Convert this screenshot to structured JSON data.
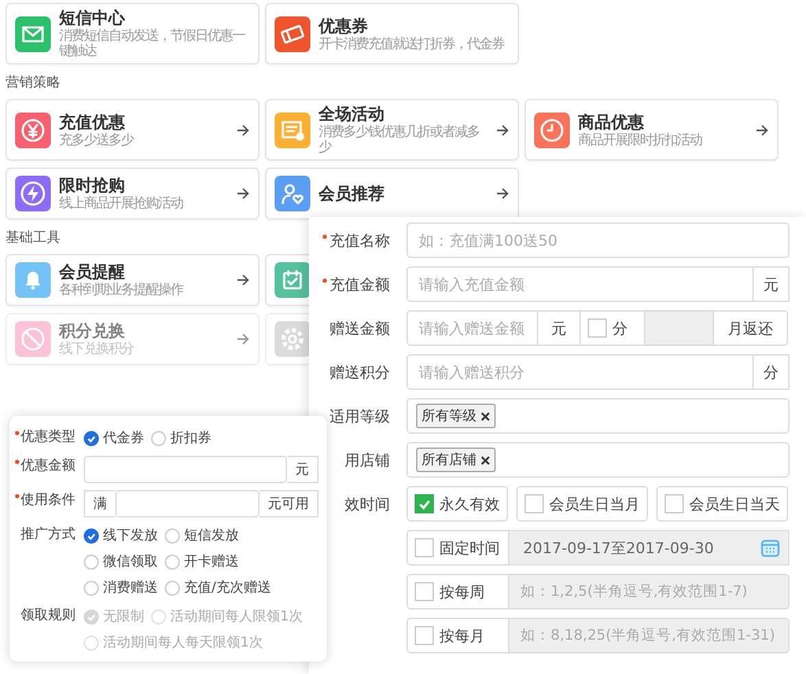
{
  "top_cards": [
    {
      "title": "短信中心",
      "desc": "消费短信自动发送，节假日优惠一键触达"
    },
    {
      "title": "优惠券",
      "desc": "开卡消费充值就送打折券，代金券"
    }
  ],
  "sections": [
    {
      "title": "营销策略",
      "rows": [
        [
          {
            "title": "充值优惠",
            "desc": "充多少送多少",
            "faded": false
          },
          {
            "title": "全场活动",
            "desc": "消费多少钱优惠几折或者减多少",
            "faded": false
          },
          {
            "title": "商品优惠",
            "desc": "商品开展限时折扣活动",
            "faded": false
          }
        ],
        [
          {
            "title": "限时抢购",
            "desc": "线上商品开展抢购活动",
            "faded": false
          },
          {
            "title": "会员推荐",
            "faded": false
          }
        ]
      ]
    },
    {
      "title": "基础工具",
      "rows": [
        [
          {
            "title": "会员提醒",
            "desc": "各种到期业务提醒操作",
            "faded": false
          },
          {
            "faded": false
          }
        ],
        [
          {
            "title": "积分兑换",
            "desc": "线下兑换积分",
            "faded": true
          },
          {
            "faded": true
          }
        ]
      ]
    }
  ],
  "recharge_form": {
    "rows": [
      {
        "kind": "text",
        "label": "充值名称",
        "required": true,
        "placeholder": "如：充值满100送50"
      },
      {
        "kind": "text",
        "label": "充值金额",
        "required": true,
        "placeholder": "请输入充值金额",
        "suffix": "元"
      },
      {
        "kind": "gift",
        "label": "赠送金额",
        "required": false,
        "placeholder": "请输入赠送金额",
        "unit": "元",
        "check": {
          "label": "分",
          "checked": false
        },
        "suffix": "月返还"
      },
      {
        "kind": "text",
        "label": "赠送积分",
        "required": false,
        "placeholder": "请输入赠送积分",
        "suffix": "分"
      },
      {
        "kind": "tags",
        "label": "适用等级",
        "required": false,
        "tags": [
          "所有等级"
        ]
      },
      {
        "kind": "tags",
        "label": "用店铺",
        "required": false,
        "tags": [
          "所有店铺"
        ]
      },
      {
        "kind": "checks",
        "label": "效时间",
        "required": false,
        "options": [
          {
            "label": "永久有效",
            "checked": true
          },
          {
            "label": "会员生日当月",
            "checked": false
          },
          {
            "label": "会员生日当天",
            "checked": false
          }
        ]
      },
      {
        "kind": "date",
        "check": {
          "label": "固定时间",
          "checked": false
        },
        "value": "2017-09-17至2017-09-30"
      },
      {
        "kind": "range",
        "check": {
          "label": "按每周",
          "checked": false
        },
        "placeholder": "如：1,2,5(半角逗号,有效范围1-7)"
      },
      {
        "kind": "range",
        "check": {
          "label": "按每月",
          "checked": false
        },
        "placeholder": "如：8,18,25(半角逗号,有效范围1-31)"
      }
    ]
  },
  "coupon_form": {
    "rows": [
      {
        "kind": "radios",
        "label": "优惠类型",
        "required": true,
        "disabled": false,
        "options": [
          {
            "label": "代金券",
            "selected": true
          },
          {
            "label": "折扣券",
            "selected": false
          }
        ]
      },
      {
        "kind": "input",
        "label": "优惠金额",
        "required": true,
        "suffix": "元"
      },
      {
        "kind": "input",
        "label": "使用条件",
        "required": true,
        "prefix": "满",
        "suffix": "元可用"
      },
      {
        "kind": "checks",
        "label": "推广方式",
        "required": false,
        "options": [
          {
            "label": "线下发放",
            "checked": true
          },
          {
            "label": "短信发放",
            "checked": false
          },
          {
            "label": "微信领取",
            "checked": false
          },
          {
            "label": "开卡赠送",
            "checked": false
          },
          {
            "label": "消费赠送",
            "checked": false
          },
          {
            "label": "充值/充次赠送",
            "checked": false
          }
        ]
      },
      {
        "kind": "radios",
        "label": "领取规则",
        "required": false,
        "disabled": true,
        "options": [
          {
            "label": "无限制",
            "selected": true
          },
          {
            "label": "活动期间每人限领1次",
            "selected": false
          },
          {
            "label": "活动期间每人每天限领1次",
            "selected": false
          }
        ]
      }
    ]
  }
}
